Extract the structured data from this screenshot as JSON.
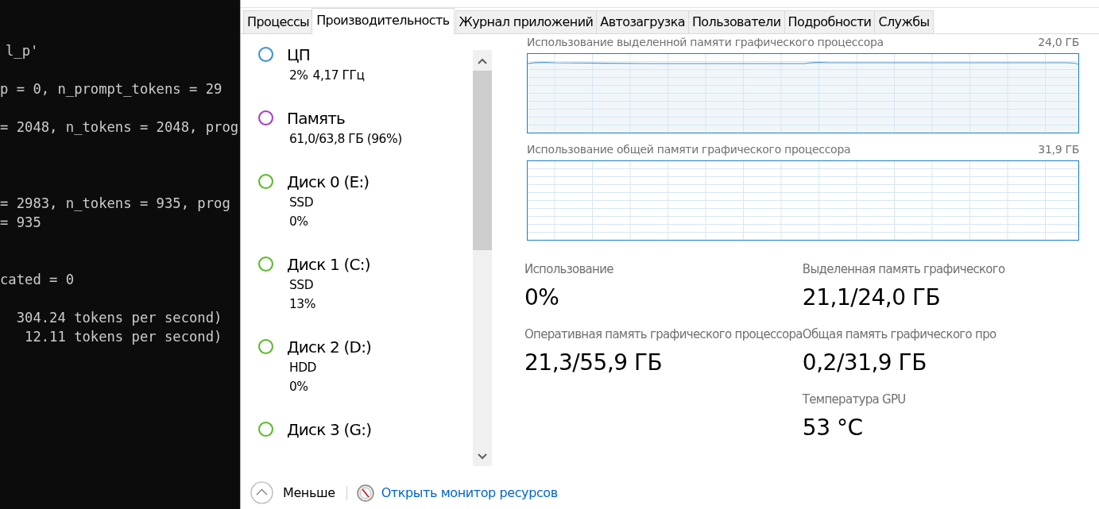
{
  "terminal": {
    "lines": [
      {
        "text": "l_p'"
      },
      {
        "text": "p = 0, n_prompt_tokens = 29"
      },
      {
        "text": "= 2048, n_tokens = 2048, prog"
      },
      {
        "text": "= 2983, n_tokens = 935, prog"
      },
      {
        "text": "= 935"
      },
      {
        "text": "cated = 0"
      },
      {
        "text": "  304.24 tokens per second)"
      },
      {
        "text": "   12.11 tokens per second)"
      }
    ]
  },
  "tabs": [
    {
      "label": "Процессы",
      "selected": false
    },
    {
      "label": "Производительность",
      "selected": true
    },
    {
      "label": "Журнал приложений",
      "selected": false
    },
    {
      "label": "Автозагрузка",
      "selected": false
    },
    {
      "label": "Пользователи",
      "selected": false
    },
    {
      "label": "Подробности",
      "selected": false
    },
    {
      "label": "Службы",
      "selected": false
    }
  ],
  "sidebar": {
    "items": [
      {
        "name": "ЦП",
        "color": "#3b8fd0",
        "details": [
          [
            "2%",
            "4,17 ГГц"
          ]
        ]
      },
      {
        "name": "Память",
        "color": "#a040c0",
        "details": [
          [
            "61,0/63,8 ГБ (96%)"
          ]
        ]
      },
      {
        "name": "Диск 0 (E:)",
        "color": "#5cb82c",
        "details": [
          [
            "SSD"
          ],
          [
            "0%"
          ]
        ]
      },
      {
        "name": "Диск 1 (C:)",
        "color": "#5cb82c",
        "details": [
          [
            "SSD"
          ],
          [
            "13%"
          ]
        ]
      },
      {
        "name": "Диск 2 (D:)",
        "color": "#5cb82c",
        "details": [
          [
            "HDD"
          ],
          [
            "0%"
          ]
        ]
      },
      {
        "name": "Диск 3 (G:)",
        "color": "#5cb82c"
      }
    ]
  },
  "graphs": [
    {
      "title": "Использование выделенной памяти графического процессора",
      "max": "24,0 ГБ",
      "kind": "filled"
    },
    {
      "title": "Использование общей памяти графического процессора",
      "max": "31,9 ГБ",
      "kind": "empty"
    }
  ],
  "stats": [
    [
      {
        "label": "Использование",
        "value": "0%"
      },
      {
        "label": "Оперативная память графического процессора",
        "value": "21,3/55,9 ГБ"
      }
    ],
    [
      {
        "label": "Выделенная память графического",
        "value": "21,1/24,0 ГБ"
      },
      {
        "label": "Общая память графического про",
        "value": "0,2/31,9 ГБ"
      },
      {
        "label": "Температура GPU",
        "value": "53 °C"
      }
    ]
  ],
  "footer": {
    "collapse_label": "Меньше",
    "link": "Открыть монитор ресурсов"
  }
}
